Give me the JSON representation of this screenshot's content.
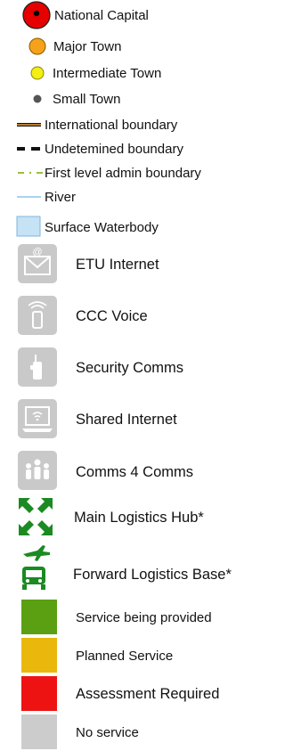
{
  "legend": {
    "symbols": [
      {
        "id": "national-capital",
        "label": "National Capital"
      },
      {
        "id": "major-town",
        "label": "Major Town",
        "color": "#f5a21a"
      },
      {
        "id": "intermediate-town",
        "label": "Intermediate Town",
        "color": "#f3ee14"
      },
      {
        "id": "small-town",
        "label": "Small Town",
        "color": "#555555"
      },
      {
        "id": "international-boundary",
        "label": "International boundary"
      },
      {
        "id": "undetermined-boundary",
        "label": "Undetemined boundary"
      },
      {
        "id": "first-level-admin-boundary",
        "label": "First level admin boundary"
      },
      {
        "id": "river",
        "label": "River",
        "color": "#a9d3ef"
      },
      {
        "id": "surface-waterbody",
        "label": "Surface Waterbody",
        "color": "#c5e3f5"
      }
    ],
    "services": [
      {
        "id": "etu-internet",
        "label": "ETU Internet",
        "icon": "envelope-at-icon"
      },
      {
        "id": "ccc-voice",
        "label": "CCC Voice",
        "icon": "mobile-phone-icon"
      },
      {
        "id": "security-comms",
        "label": "Security Comms",
        "icon": "radio-handset-icon"
      },
      {
        "id": "shared-internet",
        "label": "Shared Internet",
        "icon": "laptop-wifi-icon"
      },
      {
        "id": "comms-4-comms",
        "label": "Comms 4 Comms",
        "icon": "people-group-icon"
      }
    ],
    "logistics": [
      {
        "id": "main-logistics-hub",
        "label": "Main Logistics Hub*",
        "color": "#1b8a22"
      },
      {
        "id": "forward-logistics-base",
        "label": "Forward Logistics Base*",
        "color": "#1b8a22"
      }
    ],
    "status": [
      {
        "id": "service-being-provided",
        "label": "Service being provided",
        "color": "#5aa012"
      },
      {
        "id": "planned-service",
        "label": "Planned Service",
        "color": "#eab80c"
      },
      {
        "id": "assessment-required",
        "label": "Assessment Required",
        "color": "#ee1313"
      },
      {
        "id": "no-service",
        "label": "No service",
        "color": "#cccccc"
      }
    ]
  }
}
